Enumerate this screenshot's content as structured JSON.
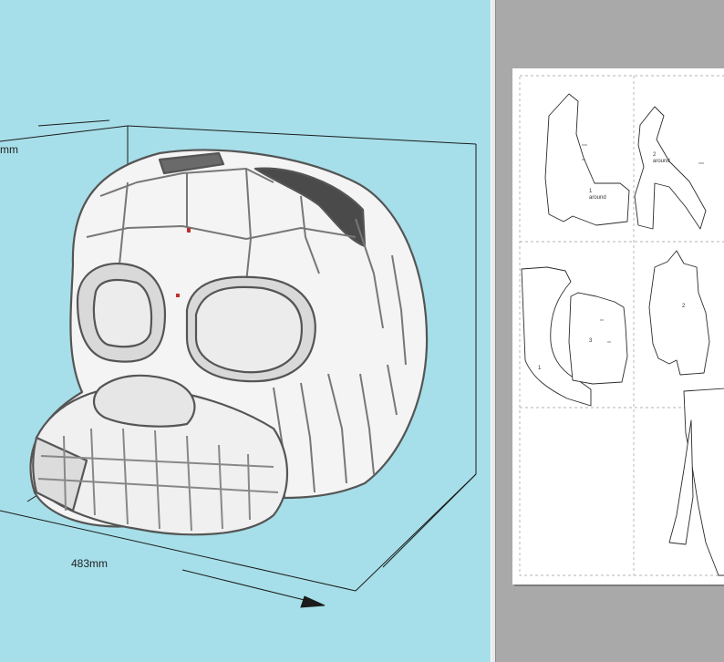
{
  "viewport_3d": {
    "background": "#a6dfe9",
    "model": "skull-mask-icon",
    "dimensions": {
      "height_label": "mm",
      "width_label": "483mm"
    }
  },
  "viewport_2d": {
    "background": "#a9a9a9",
    "sheet_color": "#ffffff",
    "pieces": [
      {
        "number": "1",
        "note": "around"
      },
      {
        "number": "2",
        "note": "around"
      },
      {
        "number": "3",
        "note": ""
      },
      {
        "number": "2",
        "note": ""
      },
      {
        "number": "1",
        "note": ""
      }
    ]
  }
}
